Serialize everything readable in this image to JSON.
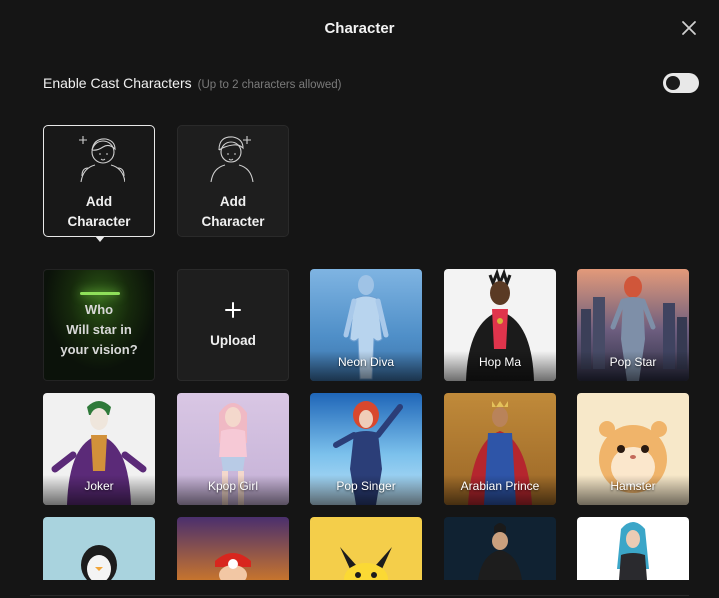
{
  "dialog": {
    "title": "Character",
    "enable_label": "Enable Cast Characters",
    "enable_hint": "(Up to 2 characters allowed)",
    "enable_toggle_on": false
  },
  "slots": [
    {
      "label": "Add\nCharacter",
      "selected": true
    },
    {
      "label": "Add\nCharacter",
      "selected": false
    }
  ],
  "grid": {
    "who_text": "Who\nWill star in\nyour vision?",
    "upload_label": "Upload",
    "characters": [
      {
        "name": "Neon Diva"
      },
      {
        "name": "Hop Ma"
      },
      {
        "name": "Pop Star"
      },
      {
        "name": "Joker"
      },
      {
        "name": "Kpop Girl"
      },
      {
        "name": "Pop Singer"
      },
      {
        "name": "Arabian Prince"
      },
      {
        "name": "Hamster"
      },
      {
        "name": ""
      },
      {
        "name": ""
      },
      {
        "name": ""
      },
      {
        "name": ""
      },
      {
        "name": ""
      }
    ]
  },
  "icons": {
    "close": "close-icon",
    "slot_figure": "character-outline-icon",
    "upload": "plus-icon"
  }
}
